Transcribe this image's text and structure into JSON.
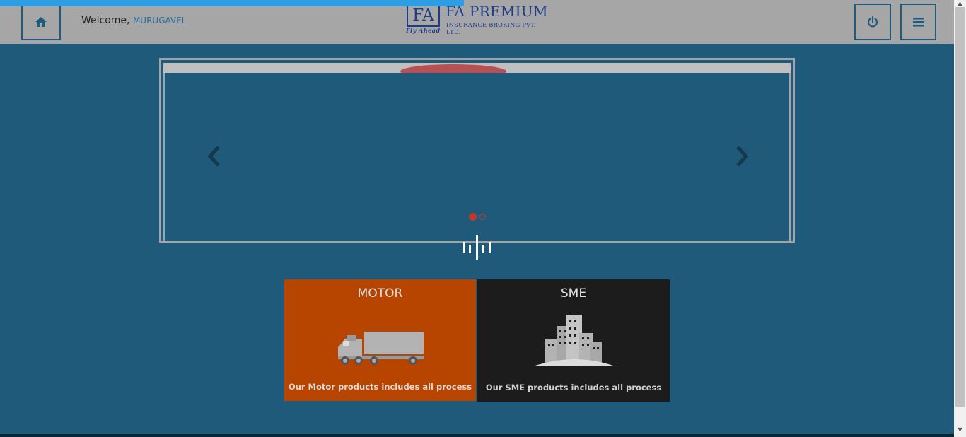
{
  "header": {
    "welcome_label": "Welcome,",
    "username": "MURUGAVEL",
    "logo": {
      "mark": "FA",
      "tagline": "Fly Ahead",
      "name": "FA PREMIUM",
      "subtitle": "INSURANCE BROKING PVT. LTD."
    },
    "icons": {
      "home": "home-icon",
      "power": "power-icon",
      "menu": "hamburger-menu-icon"
    },
    "progress_fraction": 0.48
  },
  "carousel": {
    "indicator_count": 2,
    "active_index": 0
  },
  "tiles": [
    {
      "title": "MOTOR",
      "description": "Our Motor products includes all process",
      "color": "#b74500",
      "icon": "truck-icon"
    },
    {
      "title": "SME",
      "description": "Our SME products includes all process",
      "color": "#1c1c1c",
      "icon": "buildings-icon"
    }
  ],
  "colors": {
    "page_background": "#205a7a",
    "header_background": "#a6a6a6",
    "progress_bar": "#2d9ee3",
    "accent_red": "#c0392b"
  }
}
